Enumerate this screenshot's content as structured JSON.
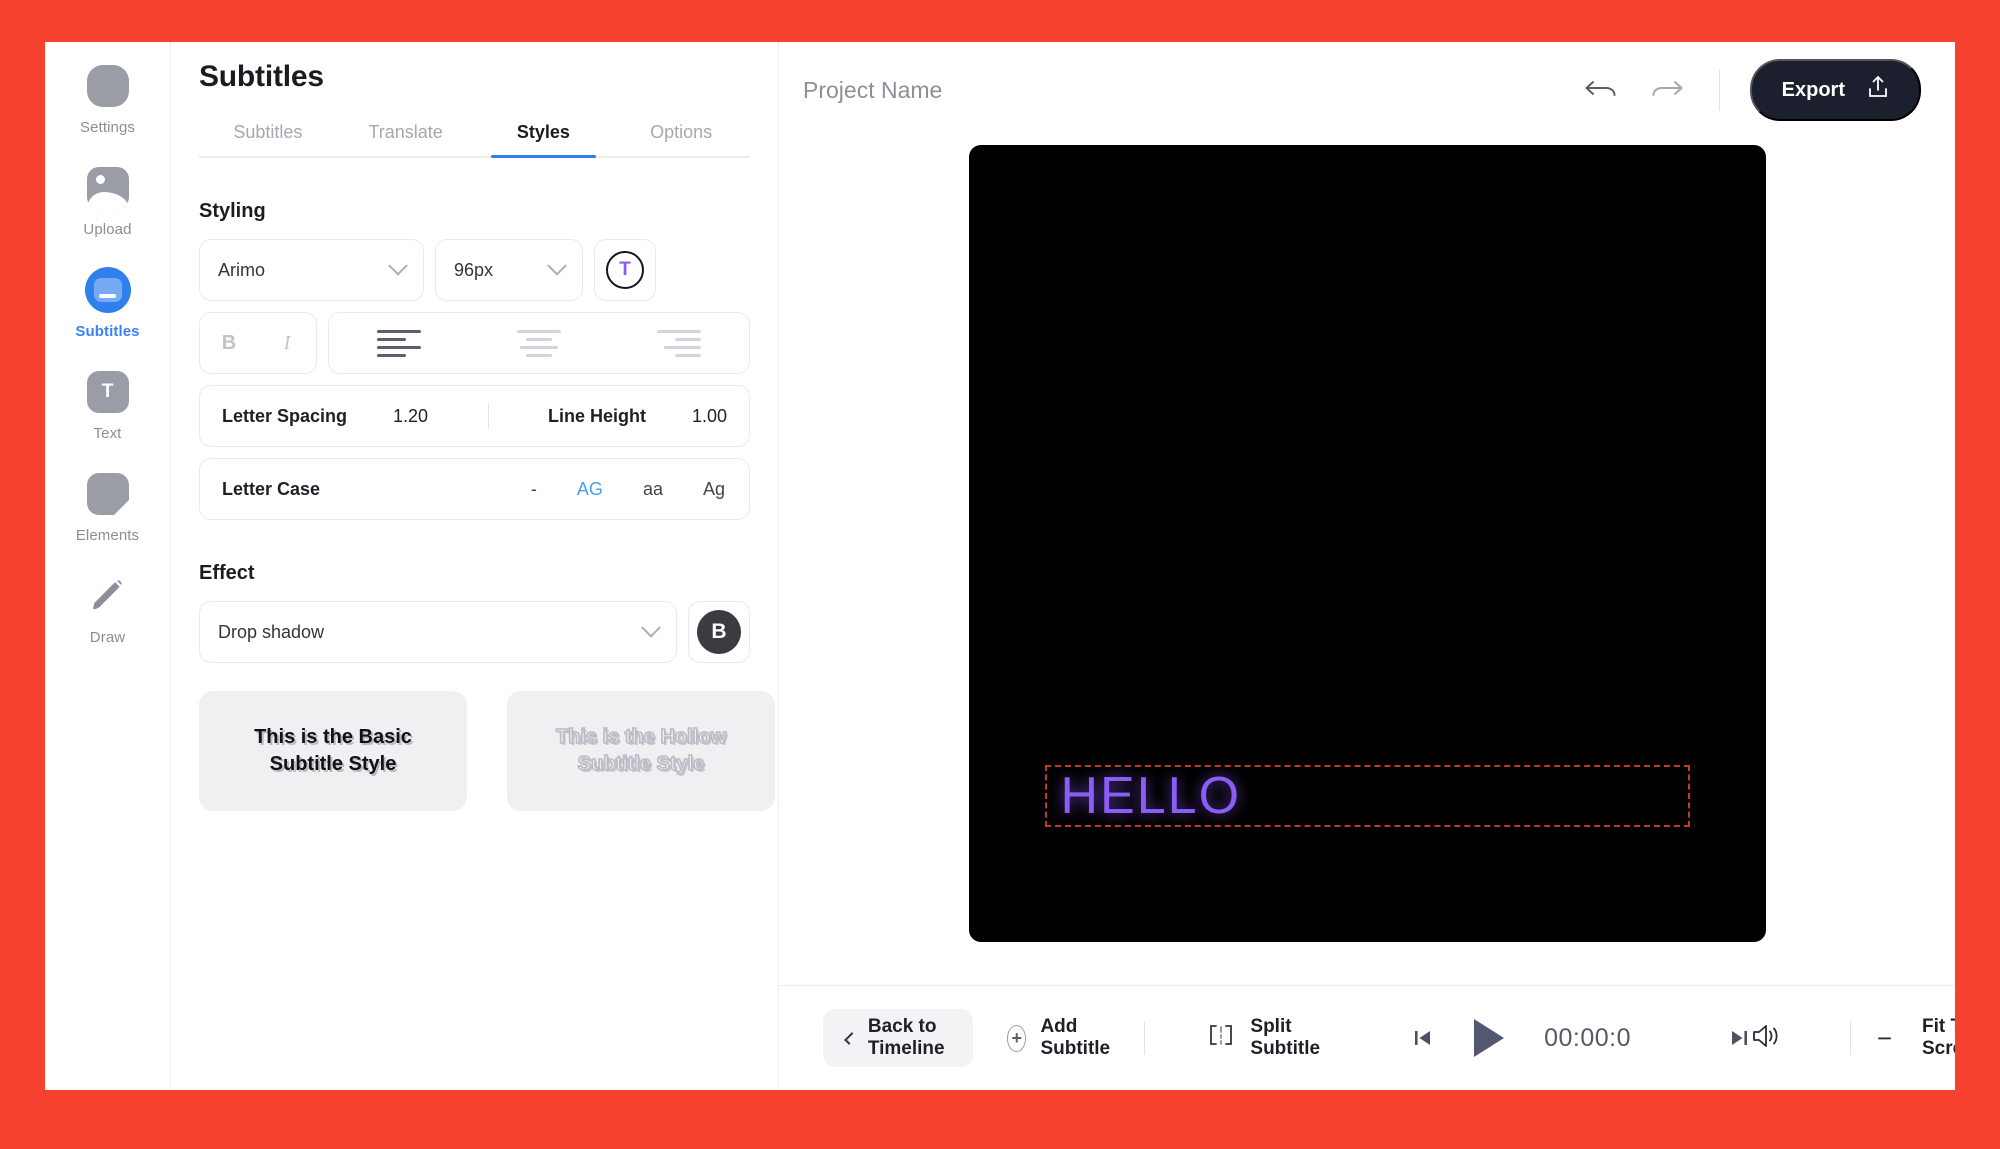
{
  "theme": {
    "frame_color": "#F5412E",
    "accent_blue": "#2F80ED",
    "subtitle_color": "#8B5CF6",
    "export_bg": "#1B1F2E"
  },
  "rail": {
    "items": [
      {
        "label": "Settings",
        "icon": "settings-blob-icon",
        "active": false
      },
      {
        "label": "Upload",
        "icon": "image-upload-icon",
        "active": false
      },
      {
        "label": "Subtitles",
        "icon": "subtitles-icon",
        "active": true
      },
      {
        "label": "Text",
        "icon": "text-t-icon",
        "active": false
      },
      {
        "label": "Elements",
        "icon": "elements-shape-icon",
        "active": false
      },
      {
        "label": "Draw",
        "icon": "pencil-draw-icon",
        "active": false
      }
    ]
  },
  "panel": {
    "title": "Subtitles",
    "tabs": [
      {
        "label": "Subtitles",
        "active": false
      },
      {
        "label": "Translate",
        "active": false
      },
      {
        "label": "Styles",
        "active": true
      },
      {
        "label": "Options",
        "active": false
      }
    ],
    "styling": {
      "section_label": "Styling",
      "font_family": "Arimo",
      "font_size": "96px",
      "color_glyph": "T",
      "bold_label": "B",
      "italic_label": "I",
      "align_active": "left",
      "letter_spacing_label": "Letter Spacing",
      "letter_spacing_value": "1.20",
      "line_height_label": "Line Height",
      "line_height_value": "1.00",
      "letter_case_label": "Letter Case",
      "letter_case_options": [
        {
          "label": "-",
          "active": false
        },
        {
          "label": "AG",
          "active": true
        },
        {
          "label": "aa",
          "active": false
        },
        {
          "label": "Ag",
          "active": false
        }
      ]
    },
    "effect": {
      "section_label": "Effect",
      "selected": "Drop shadow",
      "swatch_glyph": "B"
    },
    "style_cards": [
      {
        "text": "This is the Basic\nSubtitle Style",
        "line1": "This is the Basic",
        "line2": "Subtitle Style",
        "variant": "basic"
      },
      {
        "text": "This is the Hollow\nSubtitle Style",
        "line1": "This is the Hollow",
        "line2": "Subtitle Style",
        "variant": "hollow"
      }
    ]
  },
  "topbar": {
    "project_name": "Project Name",
    "undo_icon": "undo-arrow-icon",
    "redo_icon": "redo-arrow-icon",
    "export_label": "Export",
    "export_icon": "upload-share-icon"
  },
  "canvas": {
    "subtitle_text": "HELLO",
    "selection_border_color": "#C0392B",
    "background": "#000000"
  },
  "bottombar": {
    "back_label": "Back to Timeline",
    "back_icon": "chevron-left-icon",
    "add_label": "Add Subtitle",
    "add_icon": "plus-circle-icon",
    "split_label": "Split Subtitle",
    "split_icon": "split-brackets-icon",
    "prev_icon": "skip-previous-icon",
    "play_icon": "play-triangle-icon",
    "next_icon": "skip-next-icon",
    "timecode": "00:00:0",
    "volume_icon": "speaker-volume-icon",
    "zoom_out_label": "−",
    "zoom_label": "Fit To Screen",
    "zoom_in_label": "+"
  }
}
